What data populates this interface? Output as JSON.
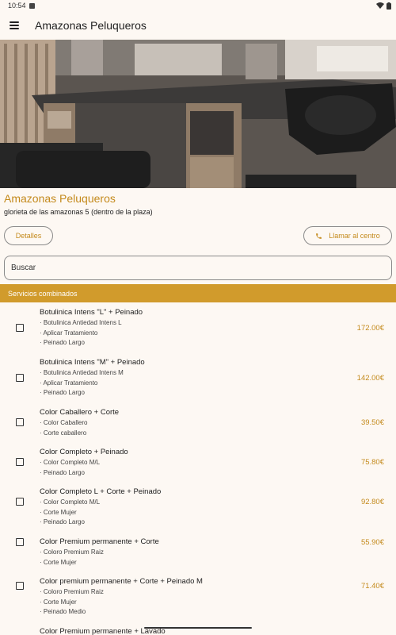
{
  "status_bar": {
    "time": "10:54"
  },
  "app_bar": {
    "title": "Amazonas Peluqueros"
  },
  "salon": {
    "name": "Amazonas Peluqueros",
    "address": "glorieta de las amazonas 5 (dentro de la plaza)"
  },
  "actions": {
    "details_label": "Detalles",
    "call_label": "Llamar al centro"
  },
  "search": {
    "placeholder": "Buscar",
    "value": ""
  },
  "section": {
    "title": "Servicios combinados"
  },
  "services": [
    {
      "name": "Botulinica Intens \"L\" + Peinado",
      "items": [
        "· Botulinica Antiedad Intens L",
        "· Aplicar Tratamiento",
        "· Peinado Largo"
      ],
      "price": "172.00€"
    },
    {
      "name": "Botulinica Intens \"M\" + Peinado",
      "items": [
        "· Botulinica Antiedad Intens M",
        "· Aplicar Tratamiento",
        "· Peinado Largo"
      ],
      "price": "142.00€"
    },
    {
      "name": "Color Caballero + Corte",
      "items": [
        "· Color Caballero",
        "· Corte caballero"
      ],
      "price": "39.50€"
    },
    {
      "name": "Color Completo + Peinado",
      "items": [
        "· Color Completo M/L",
        "· Peinado Largo"
      ],
      "price": "75.80€"
    },
    {
      "name": "Color Completo L + Corte + Peinado",
      "items": [
        "· Color Completo M/L",
        "· Corte Mujer",
        "· Peinado Largo"
      ],
      "price": "92.80€"
    },
    {
      "name": "Color Premium permanente + Corte",
      "items": [
        "· Coloro Premium Raiz",
        "· Corte Mujer"
      ],
      "price": "55.90€"
    },
    {
      "name": "Color premium permanente + Corte + Peinado M",
      "items": [
        "· Coloro Premium Raiz",
        "· Corte Mujer",
        "· Peinado Medio"
      ],
      "price": "71.40€"
    },
    {
      "name": "Color Premium permanente + Lavado",
      "items": [],
      "price": ""
    }
  ],
  "colors": {
    "accent": "#c48a1c",
    "section_bg": "#d19b2c",
    "background": "#fdf8f3"
  }
}
